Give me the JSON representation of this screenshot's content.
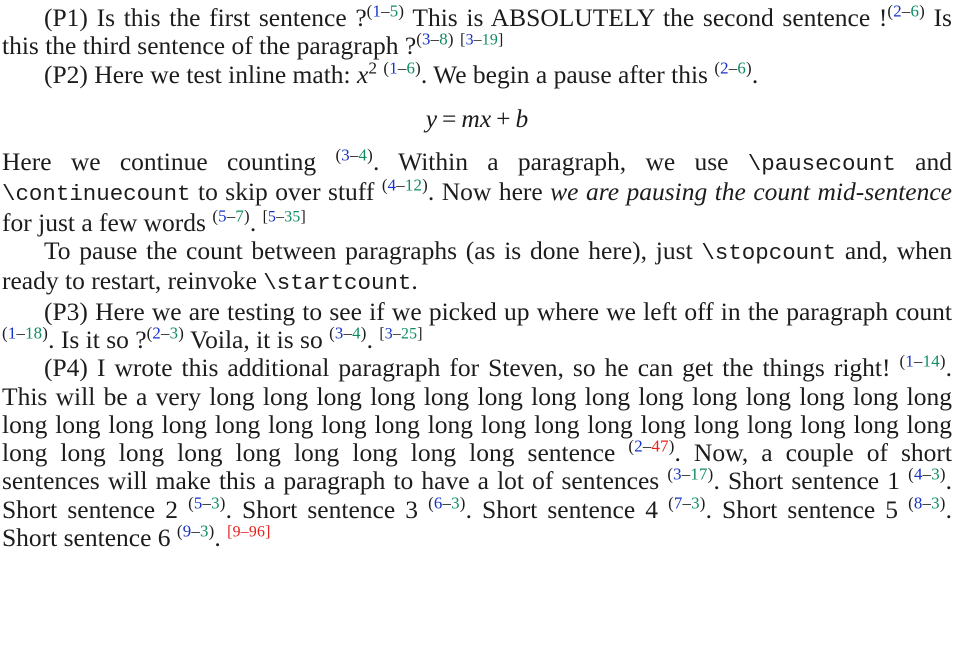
{
  "document": {
    "type": "latex-typeset-page",
    "description": "Typeset LaTeX page demonstrating sentence and word counting macros with colored superscript counters",
    "colors": {
      "text": "#1c1c1c",
      "sentence_index": "#1432c8",
      "word_count": "#0e8a64",
      "word_count_over_limit": "#e8201a",
      "background": "#ffffff"
    },
    "legend": {
      "sentence_marker_format": "(sentence-index–word-count)",
      "paragraph_marker_format": "[paragraph-index–paragraph-word-count]"
    }
  },
  "paragraphs": [
    {
      "id": "p1",
      "label": "(P1)",
      "segments": [
        {
          "kind": "text",
          "value": "(P1) Is this the first sentence ?"
        },
        {
          "kind": "mark",
          "sentence": "1",
          "words": "5",
          "over": false
        },
        {
          "kind": "text",
          "value": " This is ABSOLUTELY the second sentence !"
        },
        {
          "kind": "mark",
          "sentence": "2",
          "words": "6",
          "over": false
        },
        {
          "kind": "text",
          "value": " Is this the third sentence of the paragraph ?"
        },
        {
          "kind": "mark",
          "sentence": "3",
          "words": "8",
          "over": false
        },
        {
          "kind": "pmark",
          "paragraph": "3",
          "words": "19",
          "over": false
        }
      ]
    },
    {
      "id": "p2",
      "label": "(P2)",
      "segments": [
        {
          "kind": "text",
          "value": "(P2) Here we test inline math: "
        },
        {
          "kind": "imath",
          "base": "x",
          "sup": "2"
        },
        {
          "kind": "mark",
          "sentence": "1",
          "words": "6",
          "over": false
        },
        {
          "kind": "text",
          "value": ". We begin a pause after this "
        },
        {
          "kind": "mark",
          "sentence": "2",
          "words": "6",
          "over": false
        },
        {
          "kind": "text",
          "value": "."
        }
      ]
    }
  ],
  "equation": {
    "lhs": "y",
    "relation": "=",
    "rhs_coefficient": "m",
    "rhs_variable": "x",
    "operator": "+",
    "rhs_constant": "b",
    "plain": "y = mx + b"
  },
  "continued_paragraph": {
    "segments": [
      {
        "kind": "text",
        "value": "Here we continue counting "
      },
      {
        "kind": "mark",
        "sentence": "3",
        "words": "4",
        "over": false
      },
      {
        "kind": "text",
        "value": ". Within a paragraph, we use "
      },
      {
        "kind": "tt",
        "value": "\\pausecount"
      },
      {
        "kind": "text",
        "value": " and "
      },
      {
        "kind": "tt",
        "value": "\\continuecount"
      },
      {
        "kind": "text",
        "value": " to skip over stuff "
      },
      {
        "kind": "mark",
        "sentence": "4",
        "words": "12",
        "over": false
      },
      {
        "kind": "text",
        "value": ". Now here "
      },
      {
        "kind": "italic",
        "value": "we are pausing the count mid-sentence"
      },
      {
        "kind": "text",
        "value": " for just a few words "
      },
      {
        "kind": "mark",
        "sentence": "5",
        "words": "7",
        "over": false
      },
      {
        "kind": "text",
        "value": "."
      },
      {
        "kind": "pmark",
        "paragraph": "5",
        "words": "35",
        "over": false
      }
    ]
  },
  "stopcount_paragraph": {
    "segments": [
      {
        "kind": "text",
        "value": "To pause the count between paragraphs (as is done here), just "
      },
      {
        "kind": "tt",
        "value": "\\stopcount"
      },
      {
        "kind": "text",
        "value": " and, when ready to restart, reinvoke "
      },
      {
        "kind": "tt",
        "value": "\\startcount"
      },
      {
        "kind": "text",
        "value": "."
      }
    ]
  },
  "paragraphs_after": [
    {
      "id": "p3",
      "label": "(P3)",
      "segments": [
        {
          "kind": "text",
          "value": "(P3) Here we are testing to see if we picked up where we left off in the paragraph count "
        },
        {
          "kind": "mark",
          "sentence": "1",
          "words": "18",
          "over": false
        },
        {
          "kind": "text",
          "value": ". Is it so ?"
        },
        {
          "kind": "mark",
          "sentence": "2",
          "words": "3",
          "over": false
        },
        {
          "kind": "text",
          "value": " Voila, it is so "
        },
        {
          "kind": "mark",
          "sentence": "3",
          "words": "4",
          "over": false
        },
        {
          "kind": "text",
          "value": "."
        },
        {
          "kind": "pmark",
          "paragraph": "3",
          "words": "25",
          "over": false
        }
      ]
    },
    {
      "id": "p4",
      "label": "(P4)",
      "segments": [
        {
          "kind": "text",
          "value": "(P4) I wrote this additional paragraph for Steven, so he can get the things right! "
        },
        {
          "kind": "mark",
          "sentence": "1",
          "words": "14",
          "over": false
        },
        {
          "kind": "text",
          "value": ". This will be a very long long long long long long long long long long long long long long long long long long long long long long long long long long long long long long long long long long long long long long long long long sentence "
        },
        {
          "kind": "mark",
          "sentence": "2",
          "words": "47",
          "over": true
        },
        {
          "kind": "text",
          "value": ". Now, a couple of short sentences will make this a paragraph to have a lot of sentences "
        },
        {
          "kind": "mark",
          "sentence": "3",
          "words": "17",
          "over": false
        },
        {
          "kind": "text",
          "value": ". Short sentence 1 "
        },
        {
          "kind": "mark",
          "sentence": "4",
          "words": "3",
          "over": false
        },
        {
          "kind": "text",
          "value": ". Short sentence 2 "
        },
        {
          "kind": "mark",
          "sentence": "5",
          "words": "3",
          "over": false
        },
        {
          "kind": "text",
          "value": ". Short sentence 3 "
        },
        {
          "kind": "mark",
          "sentence": "6",
          "words": "3",
          "over": false
        },
        {
          "kind": "text",
          "value": ". Short sentence 4 "
        },
        {
          "kind": "mark",
          "sentence": "7",
          "words": "3",
          "over": false
        },
        {
          "kind": "text",
          "value": ". Short sentence 5 "
        },
        {
          "kind": "mark",
          "sentence": "8",
          "words": "3",
          "over": false
        },
        {
          "kind": "text",
          "value": ". Short sentence 6 "
        },
        {
          "kind": "mark",
          "sentence": "9",
          "words": "3",
          "over": false
        },
        {
          "kind": "text",
          "value": "."
        },
        {
          "kind": "pmark",
          "paragraph": "9",
          "words": "96",
          "over": true
        }
      ]
    }
  ]
}
